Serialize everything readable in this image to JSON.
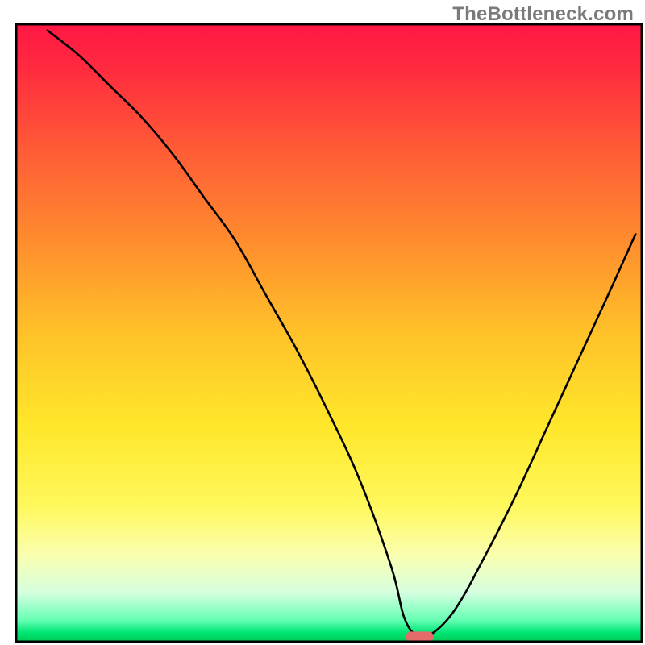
{
  "watermark": "TheBottleneck.com",
  "chart_data": {
    "type": "line",
    "title": "",
    "xlabel": "",
    "ylabel": "",
    "xlim": [
      0,
      100
    ],
    "ylim": [
      0,
      100
    ],
    "series": [
      {
        "name": "bottleneck-curve",
        "x": [
          5,
          10,
          15,
          20,
          25,
          30,
          35,
          40,
          45,
          50,
          55,
          60,
          62,
          64,
          66,
          70,
          75,
          80,
          85,
          90,
          95,
          99
        ],
        "values": [
          99,
          95,
          90,
          85,
          79,
          72,
          65,
          56,
          47,
          37,
          26,
          12,
          4,
          1,
          1,
          5,
          14,
          24,
          35,
          46,
          57,
          66
        ]
      }
    ],
    "annotations": [
      {
        "name": "optimal-marker",
        "x": 64.5,
        "y": 0.8,
        "color": "#e36b6b"
      }
    ],
    "gradient_stops": [
      {
        "offset": 0.0,
        "color": "#ff1744"
      },
      {
        "offset": 0.07,
        "color": "#ff2a3f"
      },
      {
        "offset": 0.2,
        "color": "#ff5a36"
      },
      {
        "offset": 0.35,
        "color": "#ff8c2e"
      },
      {
        "offset": 0.5,
        "color": "#ffc229"
      },
      {
        "offset": 0.65,
        "color": "#ffe72a"
      },
      {
        "offset": 0.78,
        "color": "#fff85c"
      },
      {
        "offset": 0.86,
        "color": "#faffb0"
      },
      {
        "offset": 0.92,
        "color": "#d6ffe0"
      },
      {
        "offset": 0.965,
        "color": "#66ffb3"
      },
      {
        "offset": 0.985,
        "color": "#00e676"
      },
      {
        "offset": 1.0,
        "color": "#00c853"
      }
    ],
    "frame_color": "#000000",
    "curve_color": "#000000"
  }
}
